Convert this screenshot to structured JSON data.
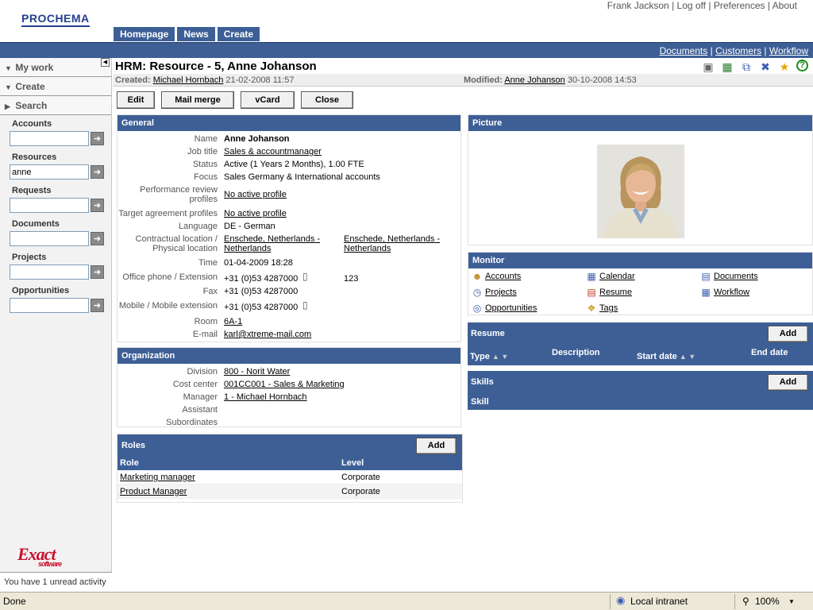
{
  "header": {
    "logo": "PROCHEMA",
    "user": "Frank Jackson",
    "links": [
      "Log off",
      "Preferences",
      "About"
    ],
    "nav": [
      "Homepage",
      "News",
      "Create"
    ],
    "sublinks": [
      "Documents",
      "Customers",
      "Workflow"
    ]
  },
  "sidebar": {
    "headers": [
      "My work",
      "Create",
      "Search"
    ],
    "sections": [
      {
        "label": "Accounts",
        "value": ""
      },
      {
        "label": "Resources",
        "value": "anne"
      },
      {
        "label": "Requests",
        "value": ""
      },
      {
        "label": "Documents",
        "value": ""
      },
      {
        "label": "Projects",
        "value": ""
      },
      {
        "label": "Opportunities",
        "value": ""
      }
    ],
    "logo": "Exact",
    "logo_sub": "software",
    "unread": "You have 1 unread activity"
  },
  "page": {
    "title": "HRM: Resource - 5, Anne Johanson",
    "created_label": "Created:",
    "created_by": "Michael Hornbach",
    "created_date": "21-02-2008 11:57",
    "modified_label": "Modified:",
    "modified_by": "Anne Johanson",
    "modified_date": "30-10-2008 14:53",
    "buttons": [
      "Edit",
      "Mail merge",
      "vCard",
      "Close"
    ]
  },
  "general": {
    "title": "General",
    "name_label": "Name",
    "name": "Anne Johanson",
    "job_label": "Job title",
    "job": "Sales & accountmanager",
    "status_label": "Status",
    "status": "Active (1 Years 2 Months), 1.00 FTE",
    "focus_label": "Focus",
    "focus": "Sales Germany & International accounts",
    "perf_label1": "Performance review",
    "perf_label2": "profiles",
    "perf": "No active profile",
    "target_label": "Target agreement profiles",
    "target": "No active profile",
    "lang_label": "Language",
    "lang": "DE - German",
    "loc_label1": "Contractual location /",
    "loc_label2": "Physical location",
    "loc1a": "Enschede, Netherlands -",
    "loc1b": "Netherlands",
    "loc2a": "Enschede, Netherlands -",
    "loc2b": "Netherlands",
    "time_label": "Time",
    "time": "01-04-2009 18:28",
    "phone_label": "Office phone / Extension",
    "phone": "+31 (0)53 4287000",
    "ext": "123",
    "fax_label": "Fax",
    "fax": "+31 (0)53 4287000",
    "mobile_label": "Mobile / Mobile extension",
    "mobile": "+31 (0)53 4287000",
    "room_label": "Room",
    "room": "6A-1",
    "email_label": "E-mail",
    "email": "karl@xtreme-mail.com"
  },
  "organization": {
    "title": "Organization",
    "division_label": "Division",
    "division": "800 - Norit Water",
    "cost_label": "Cost center",
    "cost": "001CC001 - Sales & Marketing",
    "manager_label": "Manager",
    "manager": "1 - Michael Hornbach",
    "assistant_label": "Assistant",
    "subordinates_label": "Subordinates"
  },
  "roles": {
    "title": "Roles",
    "add": "Add",
    "col_role": "Role",
    "col_level": "Level",
    "rows": [
      {
        "role": "Marketing manager",
        "level": "Corporate"
      },
      {
        "role": "Product Manager",
        "level": "Corporate"
      }
    ]
  },
  "picture": {
    "title": "Picture"
  },
  "monitor": {
    "title": "Monitor",
    "items": [
      "Accounts",
      "Calendar",
      "Documents",
      "Projects",
      "Resume",
      "Workflow",
      "Opportunities",
      "Tags"
    ]
  },
  "resume": {
    "title": "Resume",
    "add": "Add",
    "cols": [
      "Type",
      "Description",
      "Start date",
      "End date"
    ]
  },
  "skills": {
    "title": "Skills",
    "add": "Add",
    "col": "Skill"
  },
  "statusbar": {
    "left": "Done",
    "zone": "Local intranet",
    "zoom": "100%"
  }
}
